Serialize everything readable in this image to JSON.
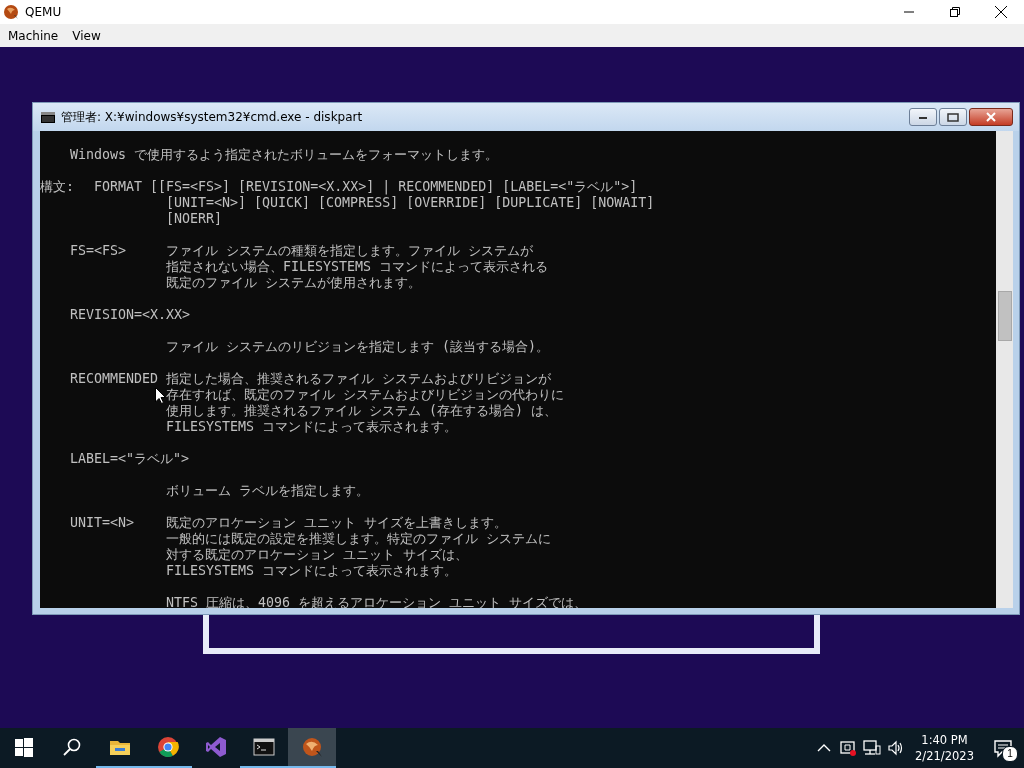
{
  "qemu_window": {
    "title": "QEMU",
    "menu": [
      "Machine",
      "View"
    ]
  },
  "cmd_window": {
    "title": "管理者: X:¥windows¥system32¥cmd.exe - diskpart",
    "console": [
      {
        "kind": "text",
        "lines": [
          "Windows で使用するよう指定されたボリュームをフォーマットします。"
        ]
      },
      {
        "kind": "syntax",
        "term": "構文:",
        "lines": [
          "FORMAT [[FS=<FS>] [REVISION=<X.XX>] | RECOMMENDED] [LABEL=<\"ラベル\">]",
          "[UNIT=<N>] [QUICK] [COMPRESS] [OVERRIDE] [DUPLICATE] [NOWAIT]",
          "[NOERR]"
        ]
      },
      {
        "kind": "option",
        "term": "FS=<FS>",
        "lines": [
          "ファイル システムの種類を指定します。ファイル システムが",
          "指定されない場合、FILESYSTEMS コマンドによって表示される",
          "既定のファイル システムが使用されます。"
        ]
      },
      {
        "kind": "option_block",
        "term": "REVISION=<X.XX>",
        "lines": [
          "ファイル システムのリビジョンを指定します (該当する場合)。"
        ]
      },
      {
        "kind": "option",
        "term": "RECOMMENDED",
        "lines": [
          "指定した場合、推奨されるファイル システムおよびリビジョンが",
          "存在すれば、既定のファイル システムおよびリビジョンの代わりに",
          "使用します。推奨されるファイル システム (存在する場合) は、",
          "FILESYSTEMS コマンドによって表示されます。"
        ]
      },
      {
        "kind": "option_block",
        "term": "LABEL=<\"ラベル\">",
        "lines": [
          "ボリューム ラベルを指定します。"
        ]
      },
      {
        "kind": "option",
        "term": "UNIT=<N>",
        "lines": [
          "既定のアロケーション ユニット サイズを上書きします。",
          "一般的には既定の設定を推奨します。特定のファイル システムに",
          "対する既定のアロケーション ユニット サイズは、",
          "FILESYSTEMS コマンドによって表示されます。"
        ]
      },
      {
        "kind": "continuation",
        "lines": [
          "NTFS 圧縮は、4096 を超えるアロケーション ユニット サイズでは、"
        ]
      }
    ]
  },
  "taskbar": {
    "items": [
      {
        "kind": "start",
        "running": false,
        "selected": false
      },
      {
        "kind": "search",
        "running": false,
        "selected": false
      },
      {
        "kind": "explorer",
        "running": true,
        "selected": false
      },
      {
        "kind": "chrome",
        "running": true,
        "selected": false
      },
      {
        "kind": "visual-studio",
        "running": false,
        "selected": false
      },
      {
        "kind": "terminal",
        "running": true,
        "selected": false
      },
      {
        "kind": "qemu",
        "running": true,
        "selected": true
      }
    ],
    "tray": {
      "time": "1:40 PM",
      "date": "2/21/2023",
      "notification_count": "1"
    }
  }
}
